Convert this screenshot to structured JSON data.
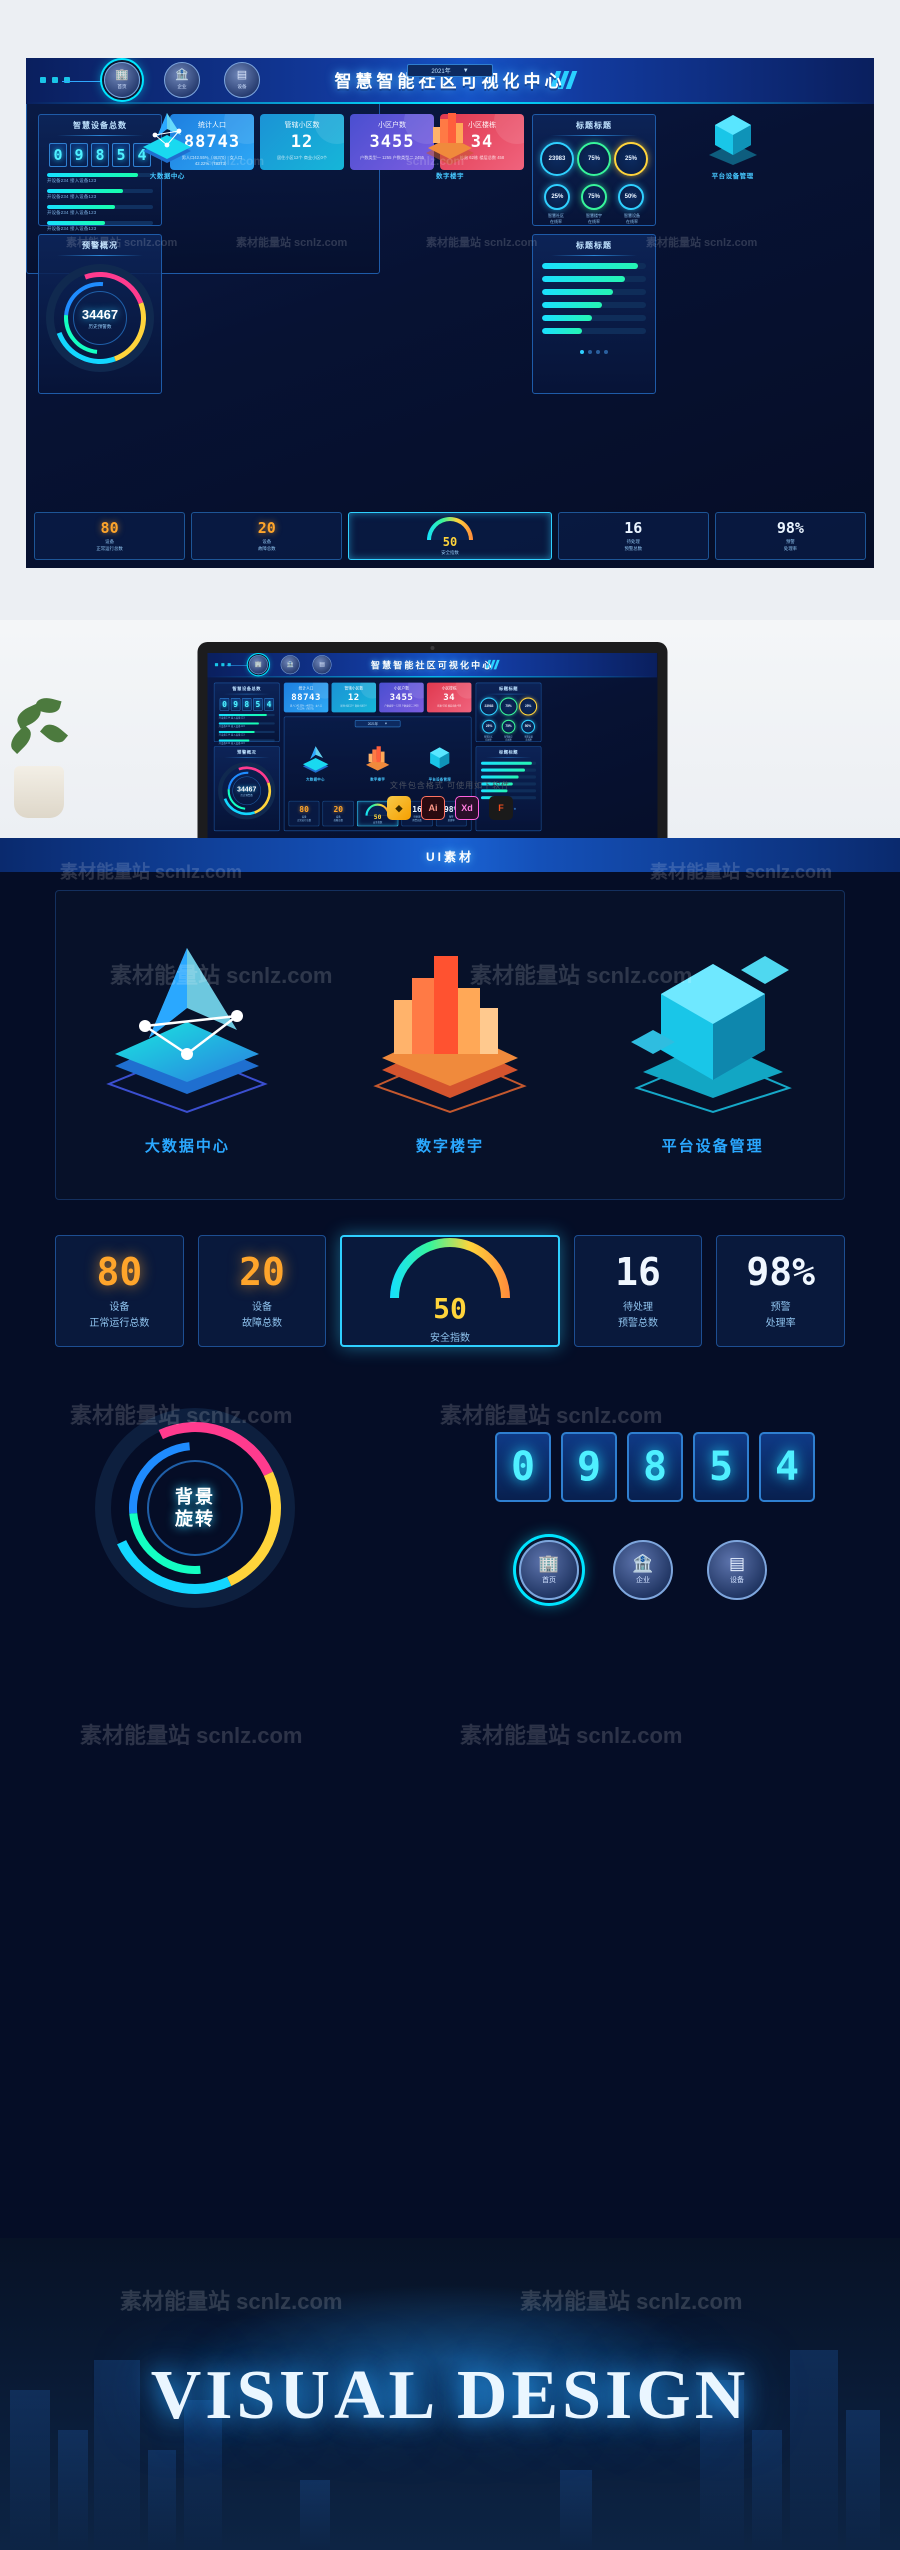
{
  "dashboard": {
    "header": {
      "title": "智慧智能社区可视化中心",
      "nav": [
        {
          "label": "首页",
          "icon": "building-icon"
        },
        {
          "label": "企业",
          "icon": "company-icon"
        },
        {
          "label": "设备",
          "icon": "device-icon"
        }
      ]
    },
    "left_top_panel": {
      "title": "智慧设备总数",
      "digits": [
        "0",
        "9",
        "8",
        "5",
        "4"
      ],
      "bars": [
        {
          "label": "开设备234  接入设备123",
          "pct": 86
        },
        {
          "label": "开设备234  接入设备123",
          "pct": 72
        },
        {
          "label": "开设备234  接入设备123",
          "pct": 64
        },
        {
          "label": "开设备234  接入设备123",
          "pct": 55
        }
      ]
    },
    "left_bottom_panel": {
      "title": "预警概况",
      "value": "34467",
      "caption": "历史预警数"
    },
    "kpis": [
      {
        "title": "统计人口",
        "value": "88743",
        "sub": "男人口42.55%（46370）\n女人口42.22%（78373）"
      },
      {
        "title": "管辖小区数",
        "value": "12",
        "sub": "居住小区12个\n商业小区0个"
      },
      {
        "title": "小区户数",
        "value": "3455",
        "sub": "户数类型一 1255\n户数类型二 2455"
      },
      {
        "title": "小区楼栋",
        "value": "34",
        "sub": "栋数 62栋\n楼层总数 458"
      }
    ],
    "center_panel": {
      "year_selector": "2021年",
      "scenes": [
        {
          "caption": "大数据中心",
          "art": "isometric-bigdata-icon"
        },
        {
          "caption": "数字楼宇",
          "art": "isometric-building-icon"
        },
        {
          "caption": "平台设备管理",
          "art": "isometric-cube-icon"
        }
      ],
      "metrics": [
        {
          "value": "80",
          "label": "设备\n正常运行总数",
          "style": "orange"
        },
        {
          "value": "20",
          "label": "设备\n故障总数",
          "style": "orange"
        },
        {
          "value": "50",
          "label": "安全指数",
          "style": "gauge"
        },
        {
          "value": "16",
          "label": "待处理\n预警总数",
          "style": "white"
        },
        {
          "value": "98%",
          "label": "预警\n处理率",
          "style": "white"
        }
      ]
    },
    "right_top_panel": {
      "title": "标题标题",
      "rings_row1": [
        {
          "value": "23983",
          "color": "#2fd0ff"
        },
        {
          "value": "75%",
          "color": "#37f59b"
        },
        {
          "value": "25%",
          "color": "#ffd43b"
        }
      ],
      "rings_row2": [
        {
          "value": "25%"
        },
        {
          "value": "75%"
        },
        {
          "value": "50%"
        }
      ],
      "ring_labels": [
        "智慧社区\n在线率",
        "智慧楼宇\n在线率",
        "智慧设备\n在线率"
      ]
    },
    "right_bottom_panel": {
      "title": "标题标题",
      "bars": [
        92,
        80,
        68,
        58,
        48,
        38
      ],
      "pages": 4,
      "active_page": 1
    }
  },
  "laptop_section": {
    "note": "文件包含格式 可使用如下软件",
    "software": [
      {
        "name": "sketch-icon",
        "glyph": "◆"
      },
      {
        "name": "illustrator-icon",
        "glyph": "Ai"
      },
      {
        "name": "adobe-xd-icon",
        "glyph": "Xd"
      },
      {
        "name": "figma-icon",
        "glyph": "F"
      }
    ]
  },
  "ui_assets": {
    "title": "UI素材",
    "scenes": [
      {
        "caption": "大数据中心"
      },
      {
        "caption": "数字楼宇"
      },
      {
        "caption": "平台设备管理"
      }
    ],
    "metrics": [
      {
        "value": "80",
        "label": "设备\n正常运行总数"
      },
      {
        "value": "20",
        "label": "设备\n故障总数"
      },
      {
        "value": "50",
        "label": "安全指数"
      },
      {
        "value": "16",
        "label": "待处理\n预警总数"
      },
      {
        "value": "98%",
        "label": "预警\n处理率"
      }
    ],
    "ring_label": "背景\n旋转",
    "digits": [
      "0",
      "9",
      "8",
      "5",
      "4"
    ],
    "nav": [
      {
        "label": "首页"
      },
      {
        "label": "企业"
      },
      {
        "label": "设备"
      }
    ]
  },
  "footer": {
    "title": "VISUAL DESIGN"
  },
  "watermarks": [
    "素材能量站  scnlz.com",
    "素材能量站",
    "scnlz.com"
  ],
  "colors": {
    "accent_cyan": "#2fd0ff",
    "accent_green": "#37f59b",
    "accent_orange": "#ffa52b",
    "accent_yellow": "#ffd43b",
    "brand_blue": "#1653c6",
    "bg_deep": "#050d26"
  }
}
